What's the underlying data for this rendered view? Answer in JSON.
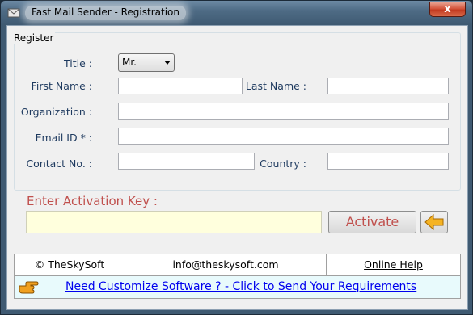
{
  "window": {
    "title": "Fast Mail Sender - Registration",
    "close_label": "x"
  },
  "register": {
    "group_title": "Register",
    "title_label": "Title :",
    "title_value": "Mr.",
    "first_name_label": "First Name :",
    "first_name_value": "",
    "last_name_label": "Last Name :",
    "last_name_value": "",
    "organization_label": "Organization :",
    "organization_value": "",
    "email_label": "Email ID * :",
    "email_value": "",
    "contact_label": "Contact No. :",
    "contact_value": "",
    "country_label": "Country :",
    "country_value": ""
  },
  "activation": {
    "key_label": "Enter Activation Key  :",
    "key_value": "",
    "activate_label": "Activate",
    "back_icon": "left-arrow-icon"
  },
  "footer": {
    "copyright": "© TheSkySoft",
    "email": "info@theskysoft.com",
    "help_link": "Online Help",
    "banner_link": "Need Customize Software ? - Click to Send Your Requirements",
    "banner_icon": "pointing-hand-icon"
  },
  "colors": {
    "label_blue": "#1e3a5f",
    "activation_red": "#c0504d",
    "key_field_bg": "#ffffdd",
    "link_blue": "#0000ee"
  }
}
